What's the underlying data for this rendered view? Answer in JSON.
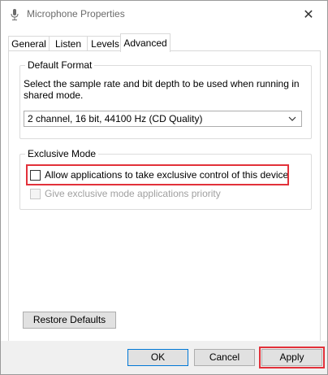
{
  "window": {
    "title": "Microphone Properties",
    "close_glyph": "✕"
  },
  "tabs": [
    {
      "label": "General"
    },
    {
      "label": "Listen"
    },
    {
      "label": "Levels"
    },
    {
      "label": "Advanced",
      "active": true
    }
  ],
  "default_format": {
    "group_label": "Default Format",
    "description": "Select the sample rate and bit depth to be used when running in shared mode.",
    "selected_value": "2 channel, 16 bit, 44100 Hz (CD Quality)"
  },
  "exclusive_mode": {
    "group_label": "Exclusive Mode",
    "allow_label": "Allow applications to take exclusive control of this device",
    "allow_checked": false,
    "priority_label": "Give exclusive mode applications priority",
    "priority_checked": false,
    "priority_enabled": false
  },
  "restore_defaults_label": "Restore Defaults",
  "footer": {
    "ok_label": "OK",
    "cancel_label": "Cancel",
    "apply_label": "Apply"
  },
  "colors": {
    "annotation_red": "#e2313a",
    "focus_blue": "#0078d7"
  },
  "icons": {
    "title": "microphone-icon",
    "dropdown": "chevron-down-icon",
    "annotation": "red-arrow-icon"
  }
}
